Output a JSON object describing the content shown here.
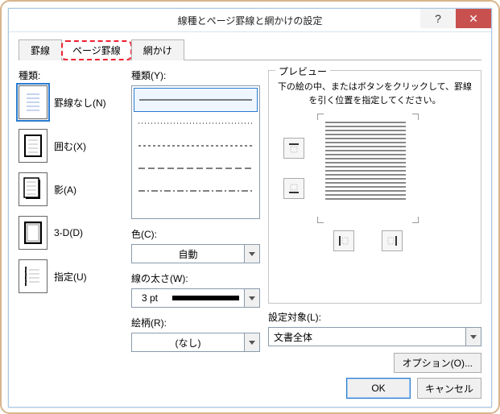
{
  "window": {
    "title": "線種とページ罫線と網かけの設定",
    "help_icon": "?",
    "close_icon": "✕"
  },
  "tabs": [
    "罫線",
    "ページ罫線",
    "網かけ"
  ],
  "col1": {
    "label": "種類:",
    "items": [
      {
        "label": "罫線なし(N)"
      },
      {
        "label": "囲む(X)"
      },
      {
        "label": "影(A)"
      },
      {
        "label": "3-D(D)"
      },
      {
        "label": "指定(U)"
      }
    ]
  },
  "col2": {
    "style_label": "種類(Y):",
    "color_label": "色(C):",
    "color_value": "自動",
    "width_label": "線の太さ(W):",
    "width_value": "3 pt",
    "art_label": "絵柄(R):",
    "art_value": "(なし)"
  },
  "col3": {
    "legend": "プレビュー",
    "hint": "下の絵の中、またはボタンをクリックして、罫線を引く位置を指定してください。",
    "apply_label": "設定対象(L):",
    "apply_value": "文書全体",
    "options_btn": "オプション(O)..."
  },
  "buttons": {
    "ok": "OK",
    "cancel": "キャンセル"
  }
}
